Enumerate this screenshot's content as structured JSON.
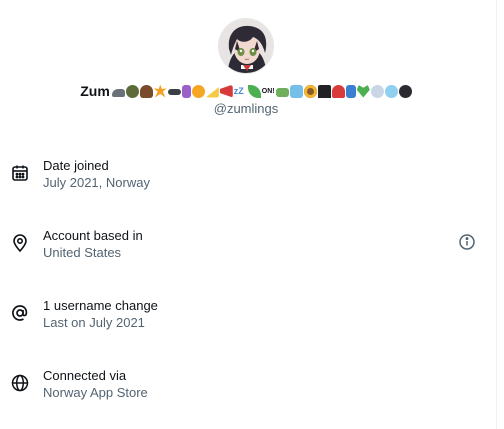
{
  "profile": {
    "display_name": "Zum",
    "display_name_emojis": [
      "shoe",
      "helmet",
      "poop",
      "explosion",
      "pistol",
      "pointing-down",
      "radioactive",
      "cheese",
      "megaphone",
      "zzz",
      "leaf",
      "on-arrow",
      "dollar-banknote",
      "snowflake",
      "sunflower",
      "top-hat",
      "mushroom",
      "socks",
      "green-heart",
      "wind",
      "bubbles",
      "bomb"
    ],
    "handle": "@zumlings",
    "avatar": "anime-avatar"
  },
  "rows": [
    {
      "icon": "calendar-icon",
      "title": "Date joined",
      "subtitle": "July 2021, Norway"
    },
    {
      "icon": "location-pin-icon",
      "title": "Account based in",
      "subtitle": "United States",
      "info_icon": "info-icon"
    },
    {
      "icon": "at-sign-icon",
      "title": "1 username change",
      "subtitle": "Last on July 2021"
    },
    {
      "icon": "globe-icon",
      "title": "Connected via",
      "subtitle": "Norway App Store"
    }
  ],
  "colors": {
    "text_primary": "#0f1419",
    "text_secondary": "#536471",
    "icon": "#0f1419",
    "divider": "#eff3f4"
  }
}
